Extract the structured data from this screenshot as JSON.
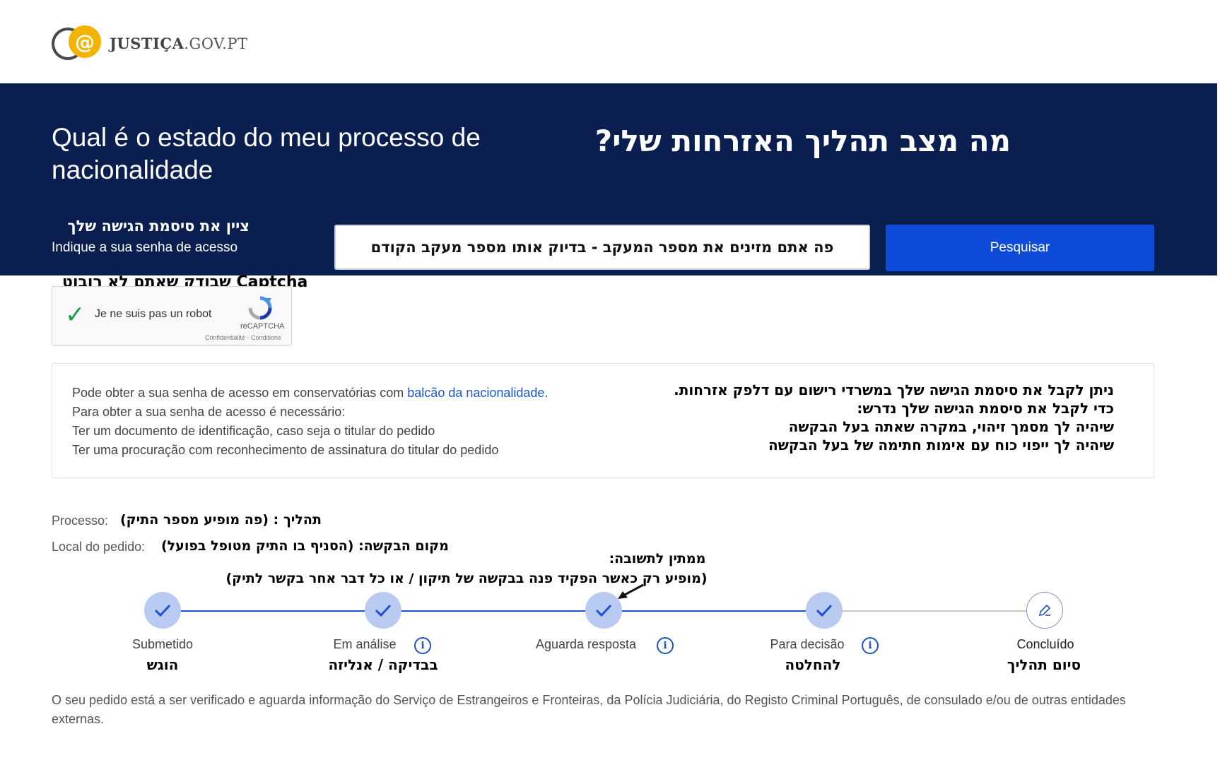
{
  "header": {
    "logo_glyph": "@",
    "logo_brand": "JUSTIÇA",
    "logo_domain": ".GOV.PT"
  },
  "banner": {
    "title_pt": "Qual é o estado do meu processo de nacionalidade",
    "title_he": "מה מצב תהליך האזרחות שלי?",
    "label_he": "ציין את סיסמת הגישה שלך",
    "label_pt": "Indique a sua senha de acesso",
    "input_text": "פה אתם מזינים את מספר המעקב - בדיוק אותו מספר מעקב הקודם",
    "search_button": "Pesquisar"
  },
  "captcha": {
    "note_he": "Captcha שבודק שאתם לא רובוט",
    "label": "Je ne suis pas un robot",
    "brand": "reCAPTCHA",
    "links": "Confidentialité - Conditions"
  },
  "info": {
    "line1_prefix": "Pode obter a sua senha de acesso em conservatórias com ",
    "line1_link": "balcão da nacionalidade",
    "line1_suffix": ".",
    "line2": "Para obter a sua senha de acesso é necessário:",
    "line3": "Ter um documento de identificação, caso seja o titular do pedido",
    "line4": "Ter uma procuração com reconhecimento de assinatura do titular do pedido",
    "he_line1": "ניתן לקבל את סיסמת הגישה שלך במשרדי רישום עם דלפק אזרחות.",
    "he_line2": "כדי לקבל את סיסמת הגישה שלך נדרש:",
    "he_line3": "שיהיה לך מסמך זיהוי, במקרה שאתה בעל הבקשה",
    "he_line4": "שיהיה לך ייפוי כוח עם אימות חתימה של בעל הבקשה"
  },
  "process": {
    "processo_label": "Processo:",
    "processo_he": "תהליך : (פה מופיע מספר התיק)",
    "local_label": "Local do pedido:",
    "local_he": "מקום הבקשה: (הסניף בו התיק מטופל בפועל)"
  },
  "annotation": {
    "line1": "ממתין לתשובה:",
    "line2": "(מופיע רק כאשר הפקיד פנה בבקשה של תיקון / או כל דבר אחר בקשר לתיק)"
  },
  "steps": [
    {
      "label": "Submetido",
      "label_he": "הוגש",
      "status": "done"
    },
    {
      "label": "Em análise",
      "label_he": "בבדיקה / אנליזה",
      "status": "done"
    },
    {
      "label": "Aguarda resposta",
      "label_he": "",
      "status": "done"
    },
    {
      "label": "Para decisão",
      "label_he": "להחלטה",
      "status": "done"
    },
    {
      "label": "Concluído",
      "label_he": "סיום תהליך",
      "status": "pending"
    }
  ],
  "footer": {
    "text": "O seu pedido está a ser verificado e aguarda informação do Serviço de Estrangeiros e Fronteiras, da Polícia Judiciária, do Registo Criminal Português, de consulado e/ou de outras entidades externas."
  },
  "colors": {
    "banner": "#0a1f4f",
    "button": "#0e4bd8",
    "step_done": "#b9cbf2",
    "step_line": "#1e4fd0",
    "link": "#1d56d6"
  }
}
